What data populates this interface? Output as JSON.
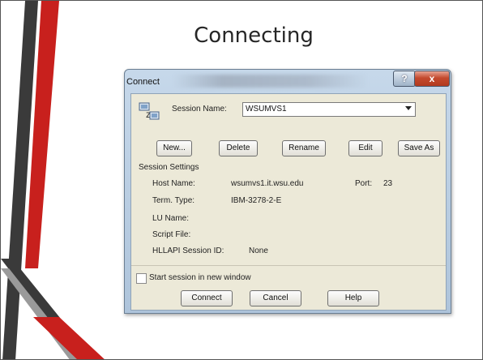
{
  "slide": {
    "title": "Connecting"
  },
  "dialog": {
    "title": "Connect",
    "help_label": "?",
    "close_label": "x",
    "session_name_label": "Session Name:",
    "session_name_value": "WSUMVS1",
    "buttons": {
      "new": "New...",
      "delete": "Delete",
      "rename": "Rename",
      "edit": "Edit",
      "save_as": "Save As"
    },
    "settings": {
      "group_label": "Session Settings",
      "host_name_label": "Host Name:",
      "host_name_value": "wsumvs1.it.wsu.edu",
      "port_label": "Port:",
      "port_value": "23",
      "term_type_label": "Term. Type:",
      "term_type_value": "IBM-3278-2-E",
      "lu_name_label": "LU Name:",
      "script_file_label": "Script File:",
      "hllapi_label": "HLLAPI Session ID:",
      "hllapi_value": "None"
    },
    "new_window_label": "Start session in new window",
    "new_window_checked": false,
    "footer": {
      "connect": "Connect",
      "cancel": "Cancel",
      "help": "Help"
    }
  },
  "colors": {
    "accent_red": "#c8201d",
    "dark_gray": "#3a3a3a",
    "titlebar": "#b9cde2",
    "close_button": "#c44a2e"
  }
}
